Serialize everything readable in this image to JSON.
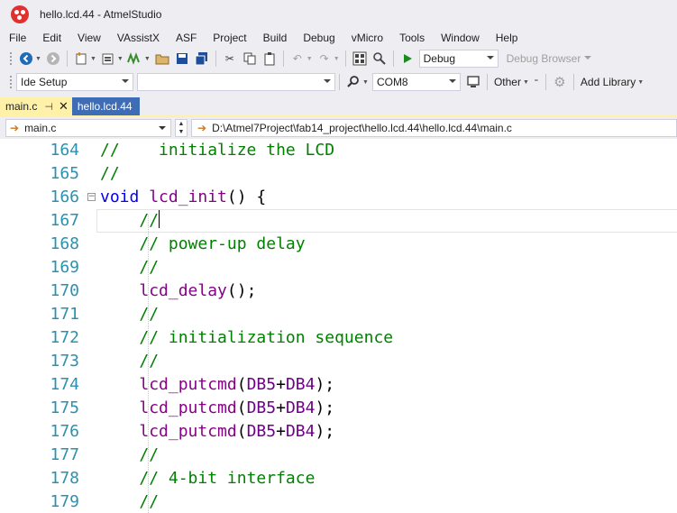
{
  "window": {
    "title": "hello.lcd.44 - AtmelStudio"
  },
  "menu": [
    "File",
    "Edit",
    "View",
    "VAssistX",
    "ASF",
    "Project",
    "Build",
    "Debug",
    "vMicro",
    "Tools",
    "Window",
    "Help"
  ],
  "toolbar1": {
    "config_value": "Debug",
    "debug_browser_label": "Debug Browser"
  },
  "toolbar2": {
    "ide_setup_value": "Ide Setup",
    "empty_combo_value": "",
    "port_value": "COM8",
    "other_label": "Other",
    "add_library_label": "Add Library"
  },
  "tabs": [
    {
      "label": "main.c",
      "active": true
    },
    {
      "label": "hello.lcd.44",
      "active": false
    }
  ],
  "navbar": {
    "member_value": "main.c",
    "path_value": "D:\\Atmel7Project\\fab14_project\\hello.lcd.44\\hello.lcd.44\\main.c"
  },
  "editor": {
    "current_line": 167,
    "lines": [
      {
        "no": "164",
        "text": "//    initialize the LCD"
      },
      {
        "no": "165",
        "text": "//"
      },
      {
        "no": "166",
        "text": "void lcd_init() {"
      },
      {
        "no": "167",
        "text": "    //"
      },
      {
        "no": "168",
        "text": "    // power-up delay"
      },
      {
        "no": "169",
        "text": "    //"
      },
      {
        "no": "170",
        "text": "    lcd_delay();"
      },
      {
        "no": "171",
        "text": "    //"
      },
      {
        "no": "172",
        "text": "    // initialization sequence"
      },
      {
        "no": "173",
        "text": "    //"
      },
      {
        "no": "174",
        "text": "    lcd_putcmd(DB5+DB4);"
      },
      {
        "no": "175",
        "text": "    lcd_putcmd(DB5+DB4);"
      },
      {
        "no": "176",
        "text": "    lcd_putcmd(DB5+DB4);"
      },
      {
        "no": "177",
        "text": "    //"
      },
      {
        "no": "178",
        "text": "    // 4-bit interface"
      },
      {
        "no": "179",
        "text": "    //"
      }
    ]
  },
  "colors": {
    "comment": "#008000",
    "keyword": "#0000ff",
    "function": "#880088",
    "macro": "#6f008a",
    "line_number": "#2b91af",
    "active_tab": "#fff1a8",
    "inactive_tab": "#3e6db5"
  }
}
